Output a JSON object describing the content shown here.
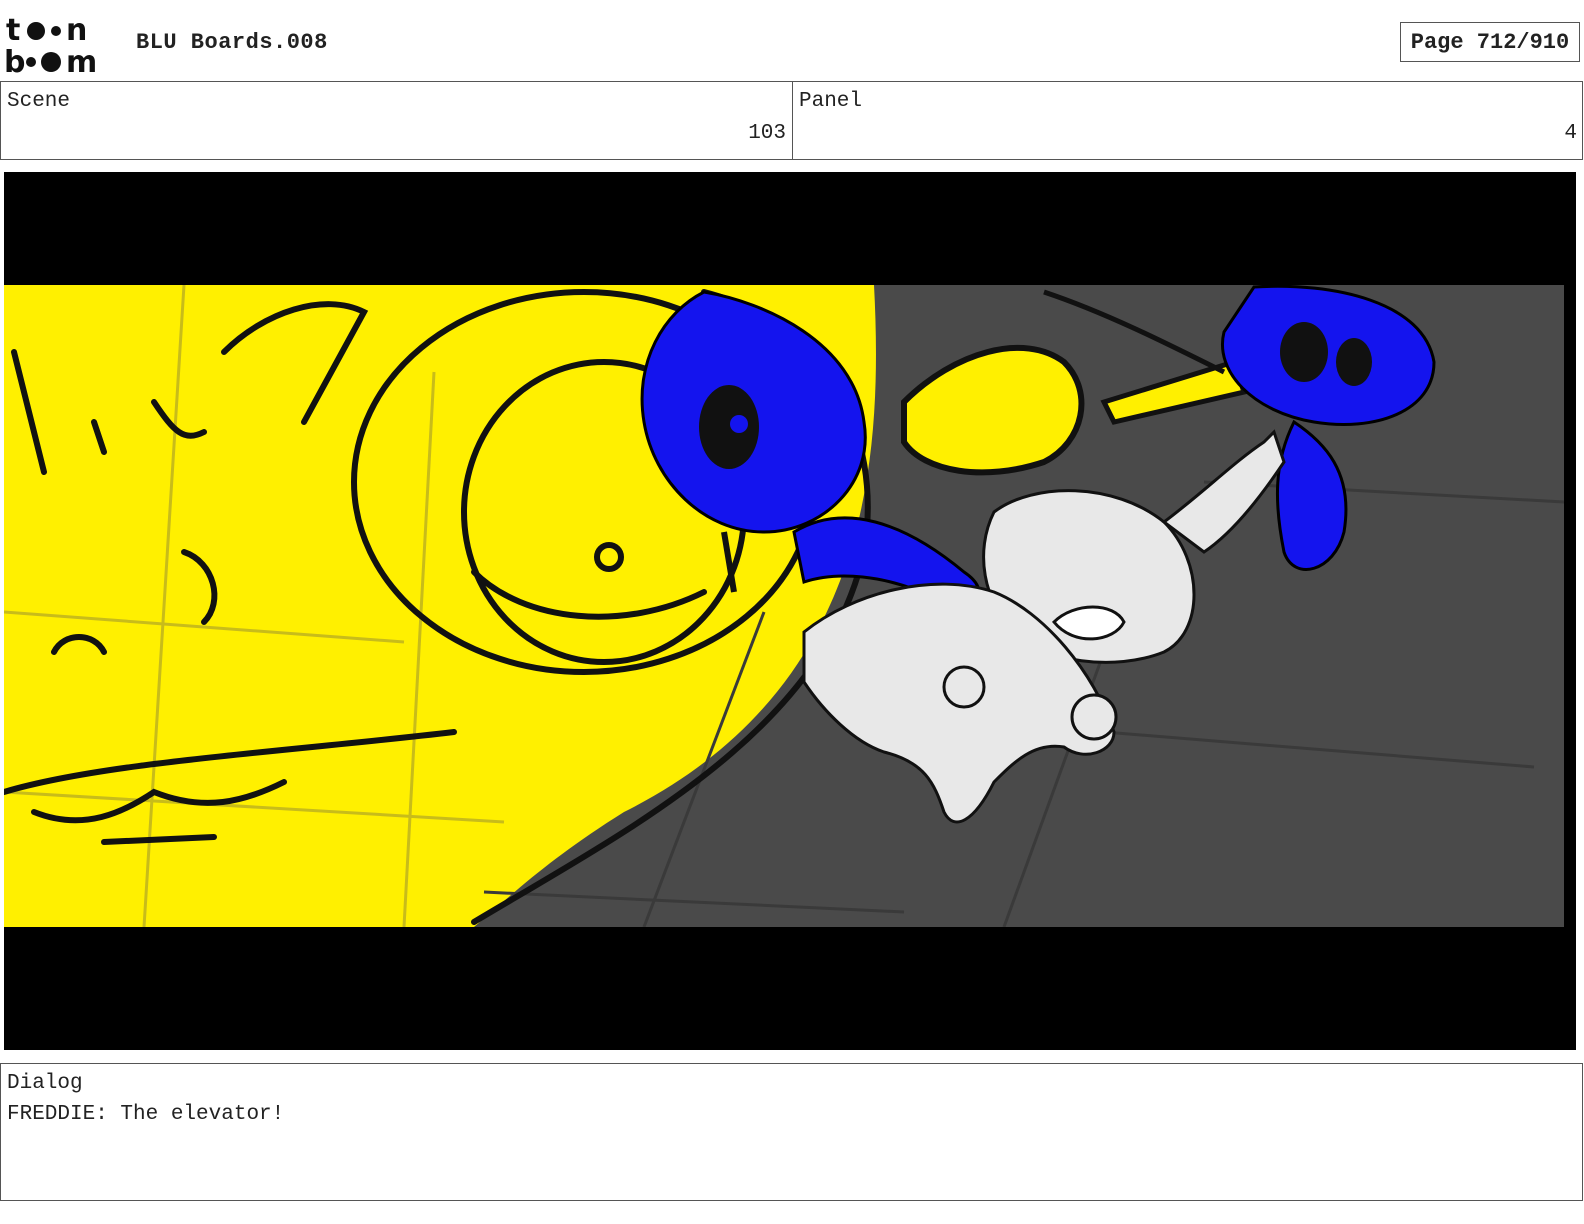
{
  "header": {
    "logo_text": "toon boom",
    "document_title": "BLU Boards.008",
    "page_indicator": "Page 712/910"
  },
  "scene": {
    "label": "Scene",
    "value": "103"
  },
  "panel": {
    "label": "Panel",
    "value": "4"
  },
  "dialog": {
    "label": "Dialog",
    "text": "FREDDIE: The elevator!"
  },
  "colors": {
    "background_yellow": "#fff000",
    "floor_gray": "#4a4a4a",
    "character_blue": "#1414ee",
    "character_white": "#e8e8e8",
    "letterbox": "#000000"
  }
}
